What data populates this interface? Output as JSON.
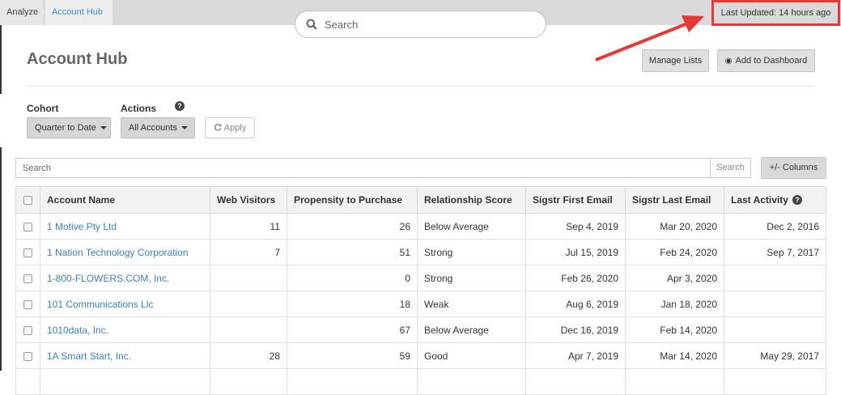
{
  "breadcrumb": {
    "home": "Analyze",
    "current": "Account Hub"
  },
  "global_search": {
    "placeholder": "Search"
  },
  "last_updated": "Last Updated: 14 hours ago",
  "page": {
    "title": "Account Hub"
  },
  "header_buttons": {
    "manage_lists": "Manage Lists",
    "add_to_dashboard": "Add to Dashboard"
  },
  "filters": {
    "cohort_label": "Cohort",
    "cohort_value": "Quarter to Date",
    "actions_label": "Actions",
    "actions_value": "All Accounts",
    "apply_label": "Apply"
  },
  "table_search": {
    "placeholder": "Search",
    "button": "Search"
  },
  "columns_button": "+/-  Columns",
  "table": {
    "headers": [
      "Account Name",
      "Web Visitors",
      "Propensity to Purchase",
      "Relationship Score",
      "Sigstr First Email",
      "Sigstr Last Email",
      "Last Activity"
    ],
    "rows": [
      [
        "1 Motive Pty Ltd",
        "11",
        "26",
        "Below Average",
        "Sep 4, 2019",
        "Mar 20, 2020",
        "Dec 2, 2016"
      ],
      [
        "1 Nation Technology Corporation",
        "7",
        "51",
        "Strong",
        "Jul 15, 2019",
        "Feb 24, 2020",
        "Sep 7, 2017"
      ],
      [
        "1-800-FLOWERS.COM, Inc.",
        "",
        "0",
        "Strong",
        "Feb 26, 2020",
        "Apr 3, 2020",
        ""
      ],
      [
        "101 Communications Llc",
        "",
        "18",
        "Weak",
        "Aug 6, 2019",
        "Jan 18, 2020",
        ""
      ],
      [
        "1010data, Inc.",
        "",
        "67",
        "Below Average",
        "Dec 16, 2019",
        "Feb 14, 2020",
        ""
      ],
      [
        "1A Smart Start, Inc.",
        "28",
        "59",
        "Good",
        "Apr 7, 2019",
        "Mar 14, 2020",
        "May 29, 2017"
      ],
      [
        "",
        "",
        "",
        "",
        "",
        "",
        ""
      ]
    ]
  },
  "colors": {
    "link": "#3a7fc4",
    "highlight_border": "#e53935",
    "arrow": "#e53935"
  }
}
